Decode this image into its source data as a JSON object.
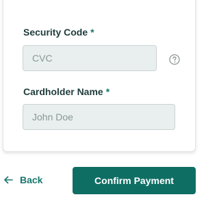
{
  "form": {
    "security_code": {
      "label": "Security Code",
      "required_marker": "*",
      "placeholder": "CVC",
      "value": "",
      "help_icon": "question-circle-icon"
    },
    "cardholder_name": {
      "label": "Cardholder Name",
      "required_marker": "*",
      "placeholder": "John Doe",
      "value": ""
    }
  },
  "footer": {
    "back_label": "Back",
    "back_icon": "arrow-left-icon",
    "confirm_label": "Confirm Payment"
  },
  "colors": {
    "accent": "#0f6e64",
    "label_text": "#1f3b3b",
    "input_background": "#e9efee",
    "input_border": "#c9d3d2",
    "placeholder_text": "#8a9796"
  }
}
